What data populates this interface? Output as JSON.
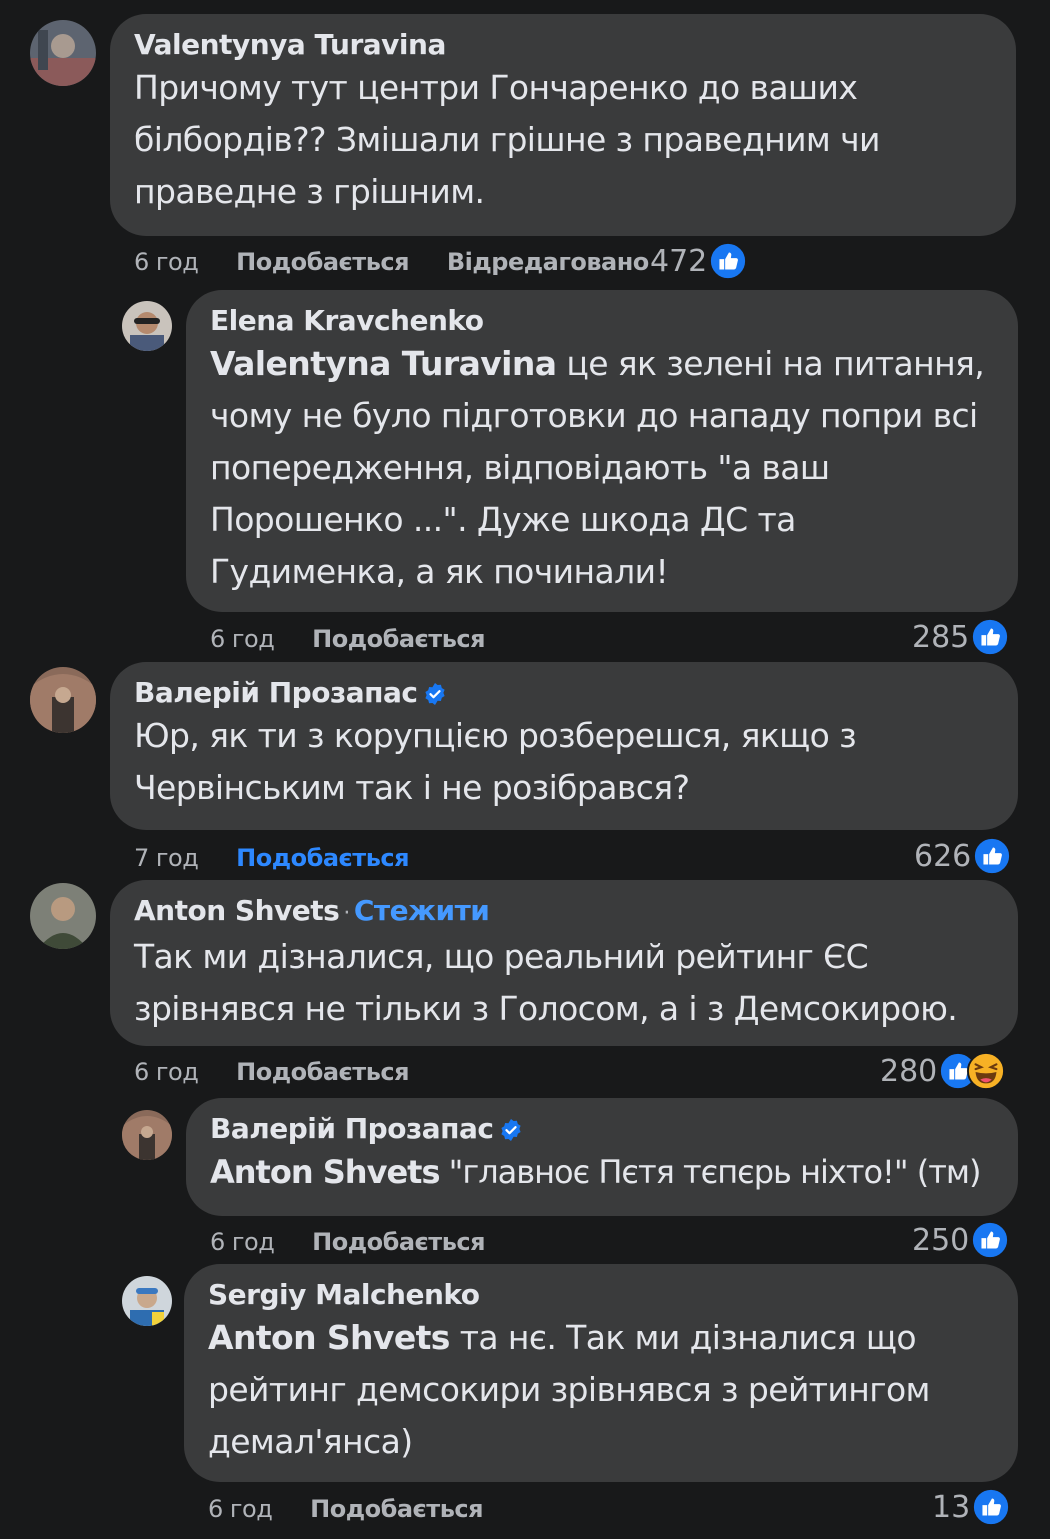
{
  "comments": [
    {
      "author": "Valentynya Turavina",
      "text": "Причому тут центри Гончаренко до ваших білбордів?? Змішали грішне з праведним чи праведне з грішним.",
      "time": "6 год",
      "like_label": "Подобається",
      "edited_label": "Відредаговано",
      "reaction_count": "472",
      "avatar_color": "#6b6f7a"
    },
    {
      "author": "Elena Kravchenko",
      "mention": "Valentyna Turavina",
      "text": " це як зелені на питання, чому не було підготовки до нападу попри всі попередження, відповідають \"а ваш Порошенко ...\". Дуже шкода ДС та Гудименка, а як починали!",
      "time": "6 год",
      "like_label": "Подобається",
      "reaction_count": "285",
      "avatar_color": "#8a8178"
    },
    {
      "author": "Валерій Прозапас",
      "verified": true,
      "text": "Юр, як ти з корупцією розберешся, якщо з Червінським так і не розібрався?",
      "time": "7 год",
      "like_label": "Подобається",
      "reaction_count": "626",
      "avatar_color": "#7a5a4a"
    },
    {
      "author": "Anton Shvets",
      "dot": "·",
      "follow_label": "Стежити",
      "text": "Так ми дізналися, що реальний рейтинг ЄС зрівнявся не тільки з Голосом, а і з Демсокирою.",
      "time": "6 год",
      "like_label": "Подобається",
      "reaction_count": "280",
      "avatar_color": "#5a5e52"
    },
    {
      "author": "Валерій Прозапас",
      "verified": true,
      "mention": "Anton Shvets",
      "text": " \"главноє Пєтя тєпєрь ніхто!\" (тм)",
      "time": "6 год",
      "like_label": "Подобається",
      "reaction_count": "250",
      "avatar_color": "#7a5a4a"
    },
    {
      "author": "Sergiy Malchenko",
      "mention": "Anton Shvets",
      "text": " та нє. Так ми дізналися що рейтинг демсокири зрівнявся з рейтингом демал'янса)",
      "time": "6 год",
      "like_label": "Подобається",
      "reaction_count": "13",
      "avatar_color": "#9aa6b0"
    }
  ],
  "colors": {
    "background": "#18191a",
    "bubble": "#3a3b3c",
    "text": "#e4e6eb",
    "secondary": "#b0b3b8",
    "accent": "#2d88ff"
  },
  "icons": [
    "like-icon",
    "haha-icon",
    "verified-badge-icon"
  ]
}
